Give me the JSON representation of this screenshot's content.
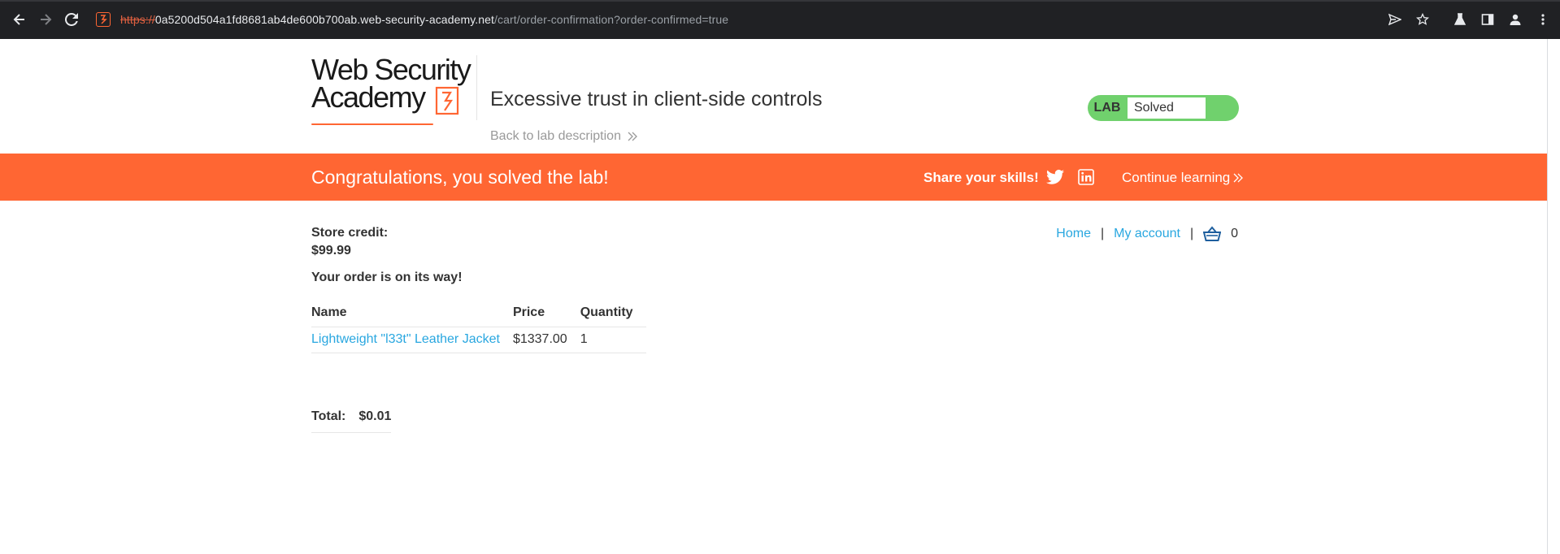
{
  "browser": {
    "url_scheme": "https://",
    "url_host": "0a5200d504a1fd8681ab4de600b700ab.web-security-academy.net",
    "url_path": "/cart/order-confirmation?order-confirmed=true"
  },
  "header": {
    "logo_line1": "Web Security",
    "logo_line2": "Academy",
    "lab_title": "Excessive trust in client-side controls",
    "back_link": "Back to lab description",
    "badge_label": "LAB",
    "badge_status": "Solved"
  },
  "banner": {
    "message": "Congratulations, you solved the lab!",
    "share_label": "Share your skills!",
    "continue_label": "Continue learning"
  },
  "nav": {
    "home": "Home",
    "separator": "|",
    "my_account": "My account",
    "cart_count": "0"
  },
  "account": {
    "credit_label": "Store credit:",
    "credit_value": "$99.99",
    "order_message": "Your order is on its way!"
  },
  "order_table": {
    "headers": [
      "Name",
      "Price",
      "Quantity"
    ],
    "rows": [
      {
        "name": "Lightweight \"l33t\" Leather Jacket",
        "price": "$1337.00",
        "quantity": "1"
      }
    ]
  },
  "total": {
    "label": "Total:",
    "value": "$0.01"
  },
  "colors": {
    "accent_orange": "#ff6633",
    "solved_green": "#70d16d",
    "link_blue": "#29a7e0"
  }
}
